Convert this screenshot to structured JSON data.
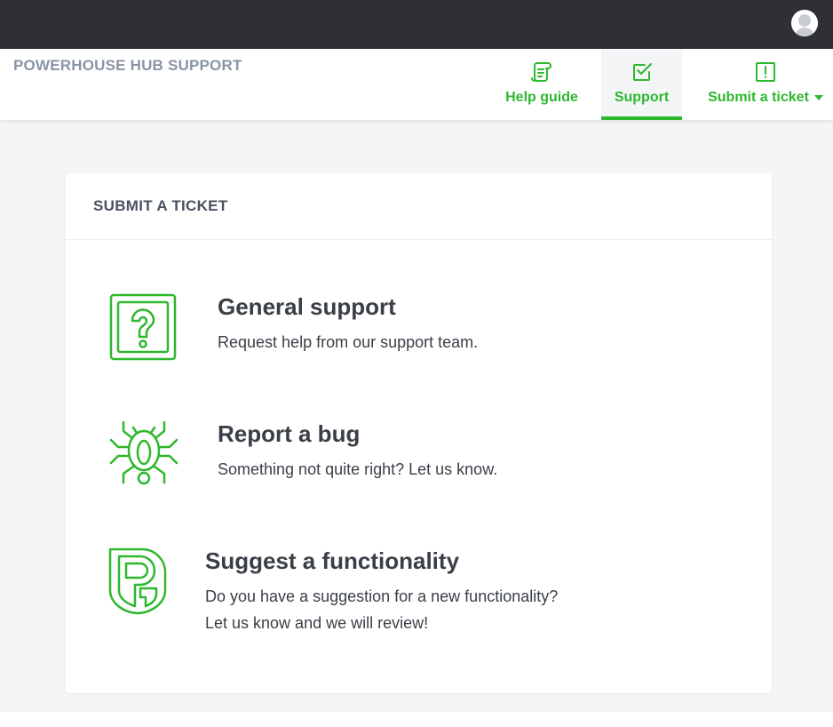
{
  "colors": {
    "accent": "#2eb82e",
    "topbar": "#2e3036",
    "brand_text": "#8a94a6",
    "page_bg": "#f4f5f7"
  },
  "topbar": {
    "avatar_icon": "user-avatar-icon"
  },
  "header": {
    "brand": "POWERHOUSE HUB SUPPORT",
    "nav": {
      "help_guide": {
        "label": "Help guide",
        "icon": "scroll-icon"
      },
      "support": {
        "label": "Support",
        "icon": "checkbox-icon",
        "active": true
      },
      "submit_ticket": {
        "label": "Submit a ticket",
        "icon": "alert-box-icon"
      }
    }
  },
  "card": {
    "title": "SUBMIT A TICKET",
    "options": [
      {
        "title": "General support",
        "description": "Request help from our support team.",
        "icon": "question-box-icon"
      },
      {
        "title": "Report a bug",
        "description": "Something not quite right? Let us know.",
        "icon": "bug-icon"
      },
      {
        "title": "Suggest a functionality",
        "description_line1": "Do you have a suggestion for a new functionality?",
        "description_line2": "Let us know and we will review!",
        "icon": "powerhouse-shield-icon"
      }
    ]
  }
}
